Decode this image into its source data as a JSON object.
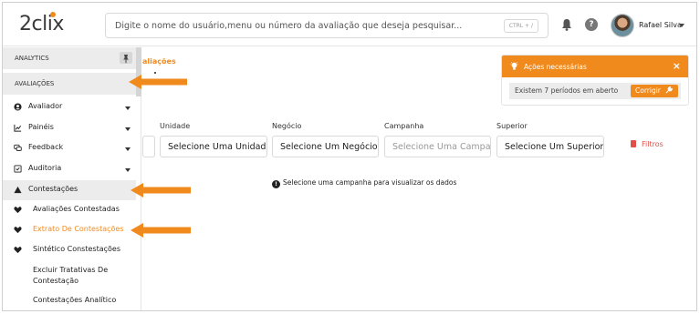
{
  "app": {
    "logo": "2clix"
  },
  "header": {
    "search_placeholder": "Digite o nome do usuário,menu ou número da avaliação que deseja pesquisar...",
    "shortcut": "CTRL + /",
    "user_name": "Rafael Silva"
  },
  "sidebar": {
    "section_analytics": "ANALYTICS",
    "section_avaliacoes": "AVALIAÇÕES",
    "items": [
      {
        "label": "Avaliador",
        "icon": "user-circle-icon"
      },
      {
        "label": "Painéis",
        "icon": "line-chart-icon"
      },
      {
        "label": "Feedback",
        "icon": "chat-icon"
      },
      {
        "label": "Auditoria",
        "icon": "checkbox-icon"
      },
      {
        "label": "Contestações",
        "icon": "warning-triangle-icon"
      }
    ],
    "subitems": [
      {
        "label": "Avaliações Contestadas",
        "icon": "heart-icon"
      },
      {
        "label": "Extrato De Contestações",
        "icon": "heart-icon"
      },
      {
        "label": "Sintético Constestações",
        "icon": "heart-icon"
      },
      {
        "label": "Excluir Tratativas De Contestação"
      },
      {
        "label": "Contestações Analítico"
      }
    ]
  },
  "main": {
    "breadcrumb": "aliações",
    "filters": [
      {
        "label": "Unidade",
        "placeholder": "Selecione Uma Unidade"
      },
      {
        "label": "Negócio",
        "placeholder": "Selecione Um Negócio"
      },
      {
        "label": "Campanha",
        "placeholder": "Selecione Uma Campanha"
      },
      {
        "label": "Superior",
        "placeholder": "Selecione Um Superior"
      }
    ],
    "clear_filters": "Filtros",
    "info_message": "Selecione uma campanha para visualizar os dados"
  },
  "actions_panel": {
    "title": "Ações necessárias",
    "close": "×",
    "message": "Existem 7 períodos em aberto",
    "button": "Corrigir"
  },
  "colors": {
    "accent": "#f18a1c",
    "danger": "#e0504a"
  }
}
